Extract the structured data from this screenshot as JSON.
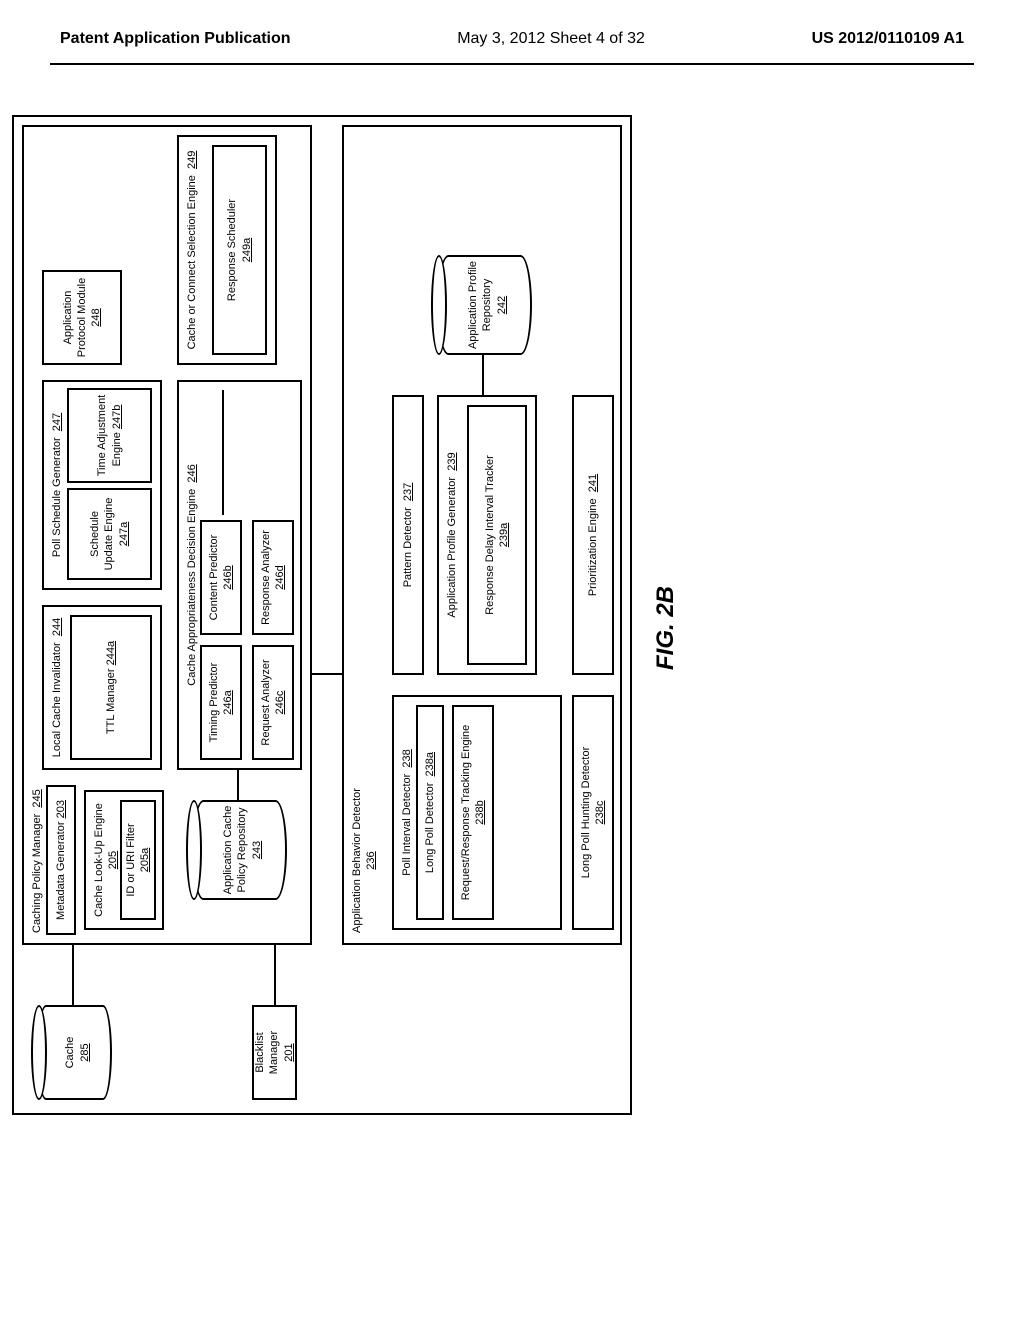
{
  "header": {
    "left": "Patent Application Publication",
    "center": "May 3, 2012  Sheet 4 of 32",
    "right": "US 2012/0110109 A1"
  },
  "boxes": {
    "caching_policy_manager": "Caching Policy Manager",
    "caching_policy_manager_ref": "245",
    "metadata_generator": "Metadata Generator",
    "metadata_generator_ref": "203",
    "cache_lookup_engine": "Cache Look-Up Engine",
    "cache_lookup_engine_ref": "205",
    "id_uri_filter": "ID or URI Filter",
    "id_uri_filter_ref": "205a",
    "local_cache_invalidator": "Local Cache Invalidator",
    "local_cache_invalidator_ref": "244",
    "ttl_manager": "TTL Manager",
    "ttl_manager_ref": "244a",
    "poll_schedule_generator": "Poll Schedule Generator",
    "poll_schedule_generator_ref": "247",
    "schedule_update_engine": "Schedule Update Engine",
    "schedule_update_engine_ref": "247a",
    "time_adjustment_engine": "Time Adjustment Engine",
    "time_adjustment_engine_ref": "247b",
    "application_protocol_module": "Application Protocol Module",
    "application_protocol_module_ref": "248",
    "cache_appropriateness": "Cache Appropriateness Decision Engine",
    "cache_appropriateness_ref": "246",
    "timing_predictor": "Timing Predictor",
    "timing_predictor_ref": "246a",
    "content_predictor": "Content Predictor",
    "content_predictor_ref": "246b",
    "request_analyzer": "Request Analyzer",
    "request_analyzer_ref": "246c",
    "response_analyzer": "Response Analyzer",
    "response_analyzer_ref": "246d",
    "cache_connect_selection": "Cache or Connect Selection Engine",
    "cache_connect_selection_ref": "249",
    "response_scheduler": "Response Scheduler",
    "response_scheduler_ref": "249a",
    "blacklist_manager": "Blacklist Manager",
    "blacklist_manager_ref": "201",
    "app_behavior_detector": "Application Behavior Detector",
    "app_behavior_detector_ref": "236",
    "poll_interval_detector": "Poll Interval Detector",
    "poll_interval_detector_ref": "238",
    "long_poll_detector": "Long Poll Detector",
    "long_poll_detector_ref": "238a",
    "req_resp_tracking": "Request/Response Tracking Engine",
    "req_resp_tracking_ref": "238b",
    "long_poll_hunting": "Long Poll Hunting Detector",
    "long_poll_hunting_ref": "238c",
    "pattern_detector": "Pattern Detector",
    "pattern_detector_ref": "237",
    "app_profile_generator": "Application Profile Generator",
    "app_profile_generator_ref": "239",
    "response_delay_tracker": "Response Delay Interval Tracker",
    "response_delay_tracker_ref": "239a",
    "prioritization_engine": "Prioritization Engine",
    "prioritization_engine_ref": "241"
  },
  "cylinders": {
    "cache": "Cache",
    "cache_ref": "285",
    "app_cache_policy_repo": "Application Cache Policy Repository",
    "app_cache_policy_repo_ref": "243",
    "app_profile_repo": "Application Profile Repository",
    "app_profile_repo_ref": "242"
  },
  "figure_label": "FIG. 2B"
}
